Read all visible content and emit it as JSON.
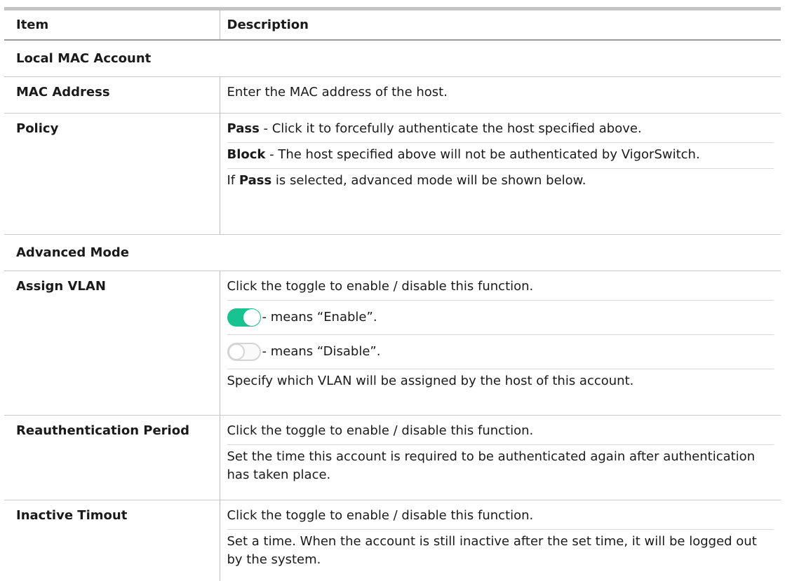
{
  "header": {
    "item": "Item",
    "description": "Description"
  },
  "sections": {
    "local_mac": "Local MAC Account",
    "advanced": "Advanced Mode"
  },
  "rows": {
    "mac_address": {
      "item": "MAC Address",
      "desc": "Enter the MAC address of the host."
    },
    "policy": {
      "item": "Policy",
      "pass_label": "Pass",
      "pass_text": " - Click it to forcefully authenticate the host specified above.",
      "block_label": "Block",
      "block_text": " - The host specified above will not be authenticated by VigorSwitch.",
      "if_text": "If ",
      "if_pass": "Pass",
      "if_rest": " is selected, advanced mode will be shown below."
    },
    "assign_vlan": {
      "item": "Assign VLAN",
      "desc1": "Click the toggle to enable / disable this function.",
      "enable_text": "- means “Enable”.",
      "disable_text": "- means “Disable”.",
      "desc2": "Specify which VLAN will be assigned by the host of this account."
    },
    "reauth": {
      "item": "Reauthentication Period",
      "desc1": "Click the toggle to enable / disable this function.",
      "desc2": "Set the time this account is required to be authenticated again after authentication has taken place."
    },
    "inactive": {
      "item": "Inactive Timout",
      "desc1": "Click the toggle to enable / disable this function.",
      "desc2": "Set a time. When the account is still inactive after the set time, it will be logged out by the system."
    }
  },
  "colors": {
    "toggle_on": "#16c391",
    "toggle_off_border": "#d4d4d4",
    "header_rule": "#c4c4c4"
  },
  "icons": {
    "toggle_on": "toggle-on-icon",
    "toggle_off": "toggle-off-icon"
  }
}
